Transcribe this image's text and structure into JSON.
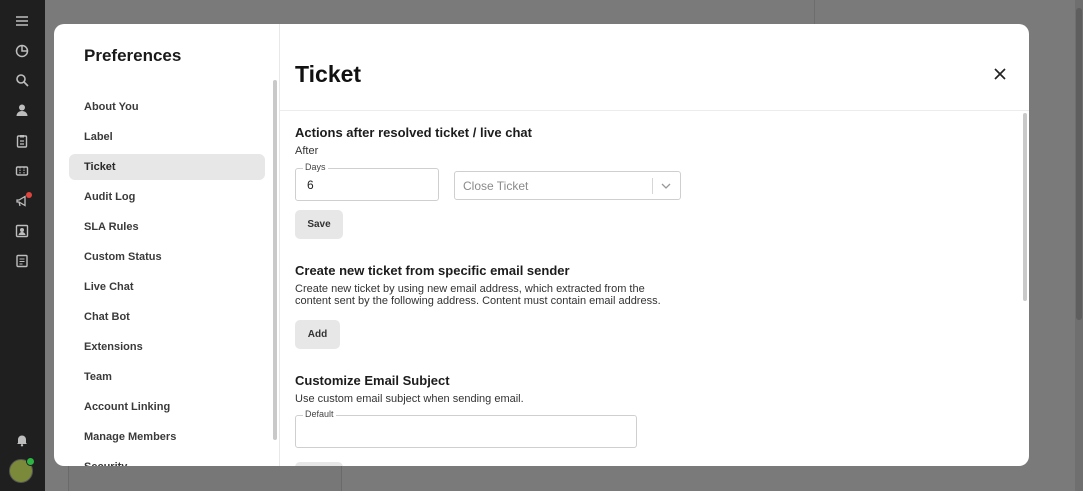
{
  "rail": {
    "icons": [
      "menu-icon",
      "pie-chart-icon",
      "search-icon",
      "user-icon",
      "clipboard-icon",
      "ticket-icon",
      "megaphone-icon",
      "contact-card-icon",
      "document-icon",
      "bell-icon"
    ]
  },
  "preferences": {
    "title": "Preferences",
    "items": [
      {
        "label": "About You"
      },
      {
        "label": "Label"
      },
      {
        "label": "Ticket"
      },
      {
        "label": "Audit Log"
      },
      {
        "label": "SLA Rules"
      },
      {
        "label": "Custom Status"
      },
      {
        "label": "Live Chat"
      },
      {
        "label": "Chat Bot"
      },
      {
        "label": "Extensions"
      },
      {
        "label": "Team"
      },
      {
        "label": "Account Linking"
      },
      {
        "label": "Manage Members"
      },
      {
        "label": "Security"
      }
    ],
    "active": "Ticket"
  },
  "content": {
    "title": "Ticket",
    "close_icon": "close-icon",
    "resolved": {
      "title": "Actions after resolved ticket / live chat",
      "after_label": "After",
      "days_label": "Days",
      "days_value": "6",
      "action_value": "Close Ticket",
      "save_label": "Save"
    },
    "email_sender": {
      "title": "Create new ticket from specific email sender",
      "description": "Create new ticket by using new email address, which extracted from the content sent by the following address. Content must contain email address.",
      "add_label": "Add"
    },
    "email_subject": {
      "title": "Customize Email Subject",
      "description": "Use custom email subject when sending email.",
      "default_label": "Default",
      "default_value": ""
    }
  },
  "colors": {
    "active_nav_bg": "#e7e7e7",
    "button_bg": "#e7e7e7",
    "overlay": "#7a7a7a",
    "rail_bg": "#1f1f1f",
    "notification_badge": "#e0443e",
    "online_dot": "#2fb344"
  }
}
